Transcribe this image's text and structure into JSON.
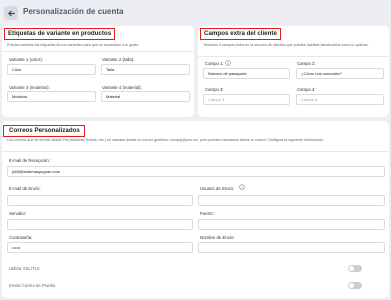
{
  "header": {
    "back_icon": "arrow-left-icon",
    "title": "Personalización de cuenta"
  },
  "variant_labels": {
    "title": "Etiquetas de variante en productos",
    "description": "Puedes cambiar las etiquetas de tus variantes para que se acomoden a tu gusto.",
    "fields": [
      {
        "label": "Variante 1 (color):",
        "value": "Color"
      },
      {
        "label": "Variante 2 (talla):",
        "value": "Talla"
      },
      {
        "label": "Variante 3 (modelos):",
        "value": "Modelos"
      },
      {
        "label": "Variante 4 (material):",
        "value": "Material"
      }
    ]
  },
  "extra_fields": {
    "title": "Campos extra del cliente",
    "description": "Tenemos 4 campos extra en la sección de clientes que puedes habilitar llamándolos como tu quieras.",
    "fields": [
      {
        "label": "Campo 1:",
        "value": "Número de pasaporte",
        "placeholder": ""
      },
      {
        "label": "Campo 2:",
        "value": "¿Cómo nos conociste?",
        "placeholder": ""
      },
      {
        "label": "Campo 3:",
        "value": "",
        "placeholder": "Campo 3"
      },
      {
        "label": "Campo 4:",
        "value": "",
        "placeholder": "Campo 4"
      }
    ]
  },
  "custom_emails": {
    "title": "Correos Personalizados",
    "description": "Los correos que se envían desde Pos (facturas, tickets, etc.) se mandan desde un correo genérico: noreply@pos.mx, pero puedes mandarlos desde tu correo! Configura la siguiente información.",
    "reception": {
      "label": "E-mail de Recepción:",
      "value": "juli3@sistemaspogran.com"
    },
    "send_email": {
      "label": "E-mail de Envío:",
      "value": ""
    },
    "send_user": {
      "label": "Usuario de Envío:",
      "value": ""
    },
    "server": {
      "label": "Servidor:",
      "value": ""
    },
    "port": {
      "label": "Puerto:",
      "value": ""
    },
    "password": {
      "label": "Contraseña:",
      "value": "••••••"
    },
    "send_name": {
      "label": "Nombre de Envío:",
      "value": ""
    },
    "ssl_toggle": {
      "label": "Utilizar SSL/TLS",
      "on": false
    },
    "test_toggle": {
      "label": "Enviar Correo de Prueba",
      "on": false
    }
  },
  "colors": {
    "background": "#eceef3",
    "card": "#ffffff",
    "highlight": "#e31b1b",
    "toggle_off": "#c9cdd5"
  }
}
